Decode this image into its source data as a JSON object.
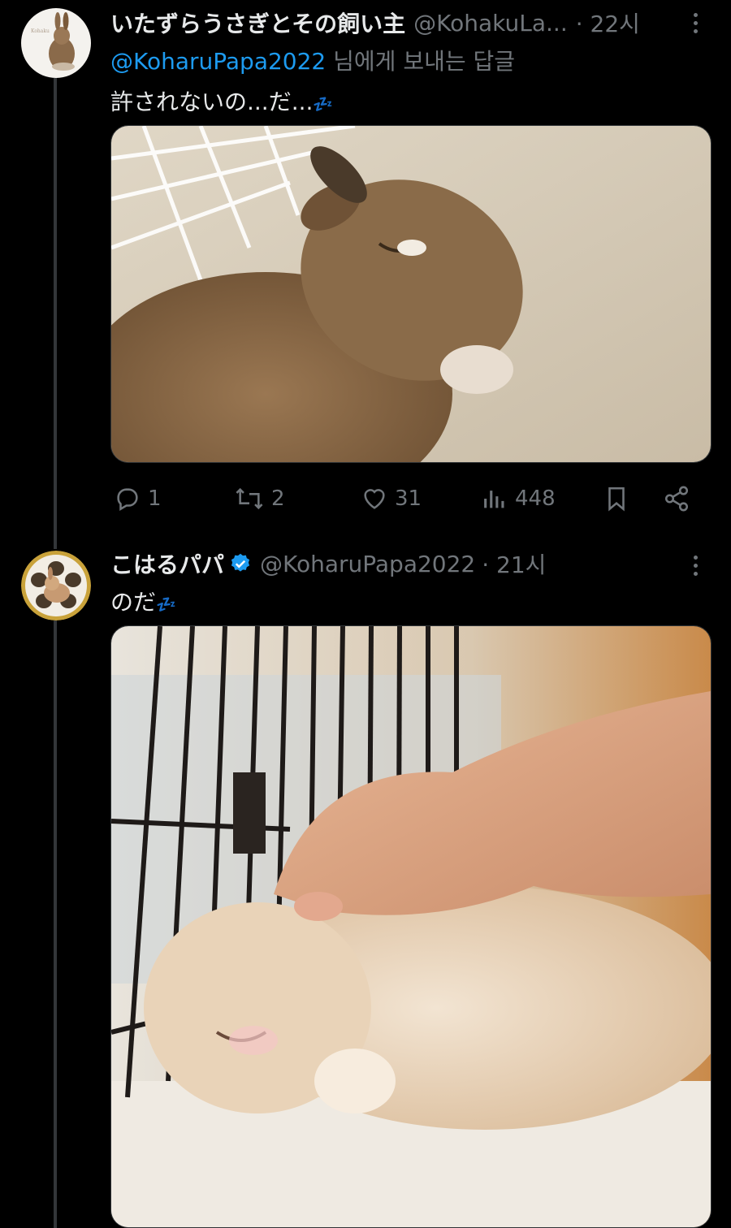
{
  "tweet1": {
    "name": "いたずらうさぎとその飼い主",
    "handle": "@KohakuLa...",
    "time": "· 22시",
    "reply_mention": "@KoharuPapa2022",
    "reply_suffix": " 님에게 보내는 답글",
    "text": "許されないの...だ...",
    "emoji": "💤",
    "stats": {
      "replies": "1",
      "retweets": "2",
      "likes": "31",
      "views": "448"
    }
  },
  "tweet2": {
    "name": "こはるパパ",
    "handle": "@KoharuPapa2022",
    "time": "· 21시",
    "text": "のだ",
    "emoji": "💤"
  },
  "colors": {
    "accent": "#1d9bf0",
    "muted": "#71767b",
    "text": "#e7e9ea",
    "background": "#000000"
  },
  "icons": [
    "more-icon",
    "reply-icon",
    "retweet-icon",
    "like-icon",
    "views-icon",
    "bookmark-icon",
    "share-icon",
    "verified-icon"
  ]
}
